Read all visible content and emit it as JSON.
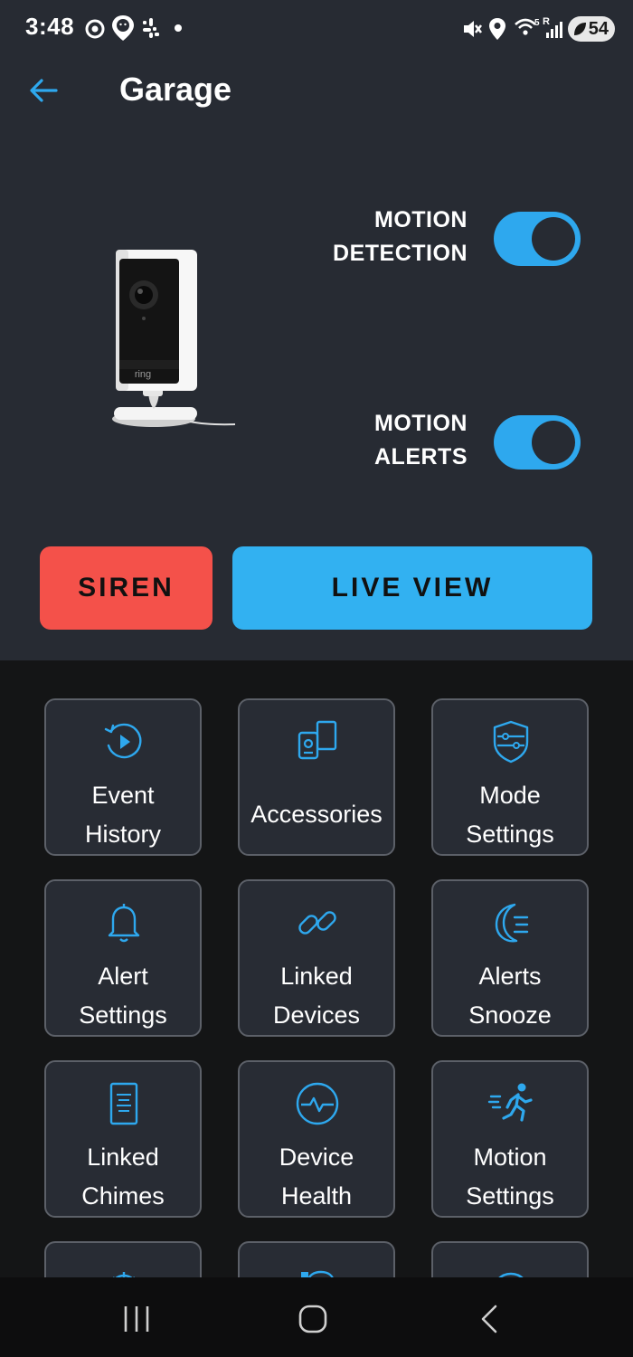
{
  "status_bar": {
    "time": "3:48",
    "battery": "54"
  },
  "header": {
    "title": "Garage"
  },
  "toggles": [
    {
      "line1": "MOTION",
      "line2": "DETECTION",
      "on": true
    },
    {
      "line1": "MOTION",
      "line2": "ALERTS",
      "on": true
    }
  ],
  "camera": {
    "brand": "ring"
  },
  "buttons": {
    "siren": "SIREN",
    "live_view": "LIVE VIEW"
  },
  "tiles": [
    {
      "line1": "Event",
      "line2": "History",
      "icon": "history-icon"
    },
    {
      "line1": "Accessories",
      "line2": "",
      "icon": "accessories-icon"
    },
    {
      "line1": "Mode",
      "line2": "Settings",
      "icon": "shield-icon"
    },
    {
      "line1": "Alert",
      "line2": "Settings",
      "icon": "bell-icon"
    },
    {
      "line1": "Linked",
      "line2": "Devices",
      "icon": "link-icon"
    },
    {
      "line1": "Alerts",
      "line2": "Snooze",
      "icon": "moon-icon"
    },
    {
      "line1": "Linked",
      "line2": "Chimes",
      "icon": "chime-icon"
    },
    {
      "line1": "Device",
      "line2": "Health",
      "icon": "health-icon"
    },
    {
      "line1": "Motion",
      "line2": "Settings",
      "icon": "running-icon"
    }
  ],
  "colors": {
    "accent": "#2ea8ee",
    "siren": "#f4514a",
    "panel": "#272b33",
    "tile": "#282c34"
  }
}
